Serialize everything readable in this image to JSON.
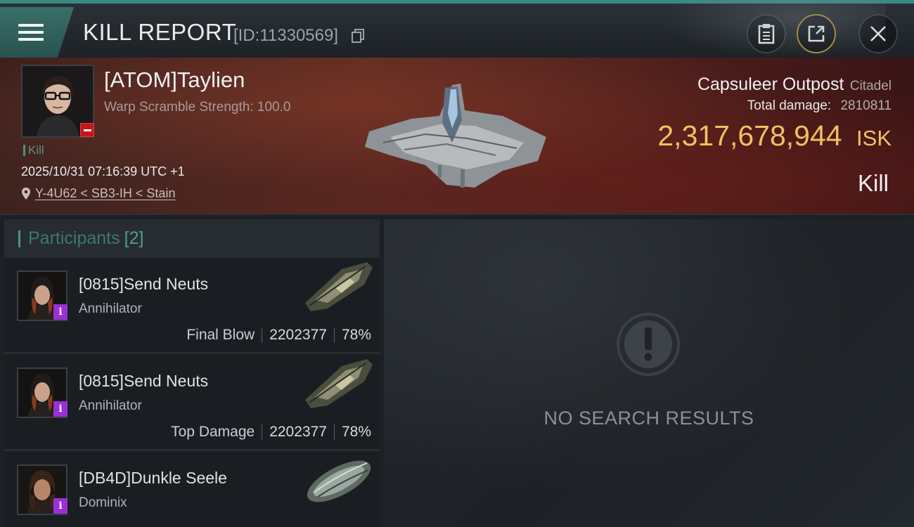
{
  "header": {
    "title": "KILL REPORT",
    "report_id": "[ID:11330569]"
  },
  "victim": {
    "name": "[ATOM]Taylien",
    "warp_scramble": "Warp Scramble Strength: 100.0",
    "tag": "Kill",
    "datetime": "2025/10/31 07:16:39 UTC +1",
    "location": "Y-4U62 < SB3-IH < Stain",
    "ship_name": "Capsuleer Outpost",
    "ship_class": "Citadel",
    "total_damage_label": "Total damage:",
    "total_damage_value": "2810811",
    "isk_value": "2,317,678,944",
    "isk_unit": "ISK",
    "result": "Kill"
  },
  "participants": {
    "label": "Participants",
    "count": "[2]",
    "rows": [
      {
        "name": "[0815]Send Neuts",
        "ship": "Annihilator",
        "role": "Final Blow",
        "damage": "2202377",
        "percent": "78%"
      },
      {
        "name": "[0815]Send Neuts",
        "ship": "Annihilator",
        "role": "Top Damage",
        "damage": "2202377",
        "percent": "78%"
      },
      {
        "name": "[DB4D]Dunkle Seele",
        "ship": "Dominix"
      }
    ]
  },
  "results": {
    "empty_text": "NO SEARCH RESULTS"
  },
  "colors": {
    "accent_teal": "#3a8a84",
    "isk_gold": "#f0c060",
    "badge_red": "#c8161b",
    "badge_purple": "#9b2fd6"
  },
  "icons": {
    "menu": "hamburger-icon",
    "copy": "copy-icon",
    "clipboard": "clipboard-icon",
    "share": "share-icon",
    "close": "close-icon",
    "location": "location-pin-icon",
    "empty": "exclamation-icon"
  }
}
